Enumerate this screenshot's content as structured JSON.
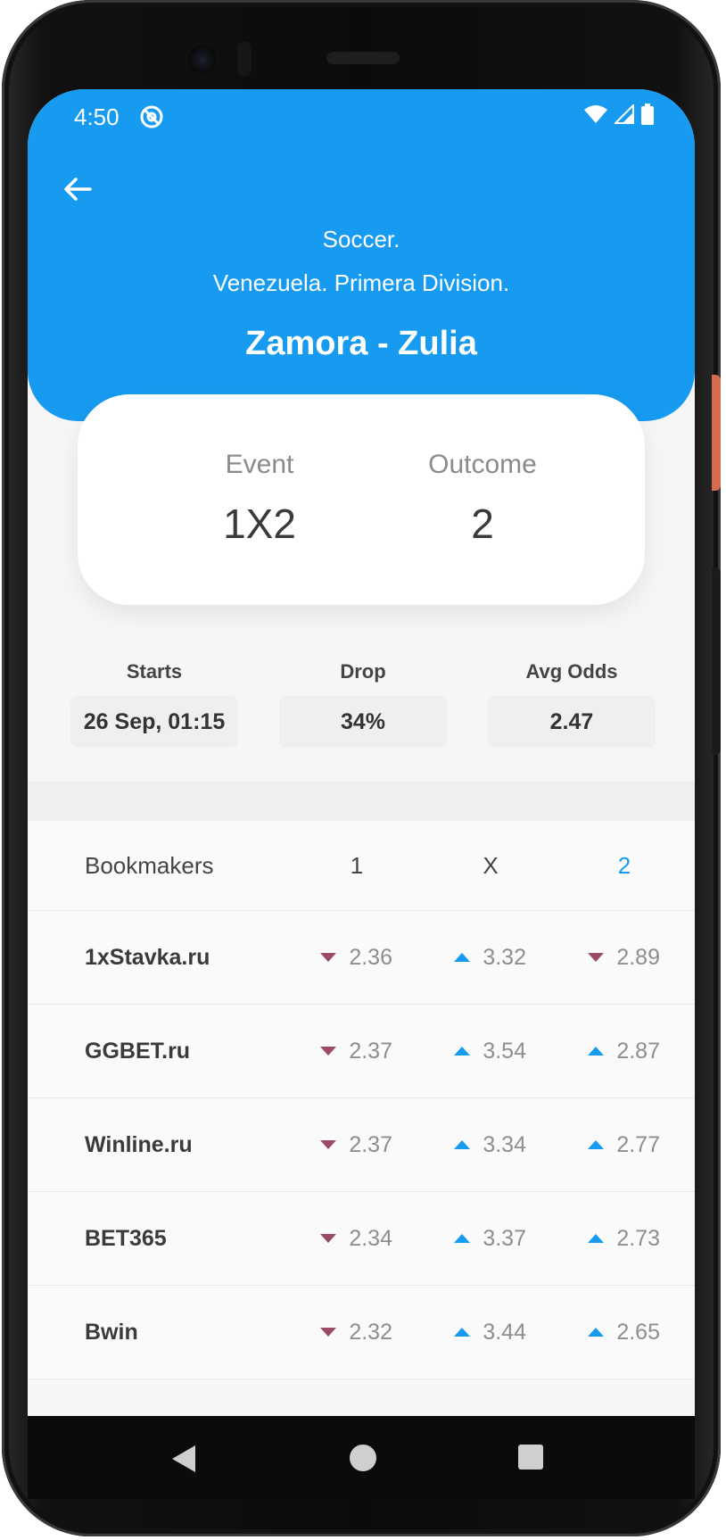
{
  "status_bar": {
    "time": "4:50"
  },
  "header": {
    "sport": "Soccer.",
    "league": "Venezuela. Primera Division.",
    "match": "Zamora - Zulia"
  },
  "card": {
    "event_label": "Event",
    "event_value": "1X2",
    "outcome_label": "Outcome",
    "outcome_value": "2"
  },
  "stats": {
    "starts_label": "Starts",
    "starts_value": "26 Sep, 01:15",
    "drop_label": "Drop",
    "drop_value": "34%",
    "avg_label": "Avg Odds",
    "avg_value": "2.47"
  },
  "table": {
    "headers": {
      "bookmakers": "Bookmakers",
      "c1": "1",
      "cx": "X",
      "c2": "2"
    },
    "rows": [
      {
        "name": "1xStavka.ru",
        "o1": "2.36",
        "o1_dir": "down",
        "ox": "3.32",
        "ox_dir": "up",
        "o2": "2.89",
        "o2_dir": "down"
      },
      {
        "name": "GGBET.ru",
        "o1": "2.37",
        "o1_dir": "down",
        "ox": "3.54",
        "ox_dir": "up",
        "o2": "2.87",
        "o2_dir": "up"
      },
      {
        "name": "Winline.ru",
        "o1": "2.37",
        "o1_dir": "down",
        "ox": "3.34",
        "ox_dir": "up",
        "o2": "2.77",
        "o2_dir": "up"
      },
      {
        "name": "BET365",
        "o1": "2.34",
        "o1_dir": "down",
        "ox": "3.37",
        "ox_dir": "up",
        "o2": "2.73",
        "o2_dir": "up"
      },
      {
        "name": "Bwin",
        "o1": "2.32",
        "o1_dir": "down",
        "ox": "3.44",
        "ox_dir": "up",
        "o2": "2.65",
        "o2_dir": "up"
      }
    ]
  },
  "colors": {
    "accent": "#169bf0",
    "down": "#9c4a6a",
    "up": "#169bf0"
  },
  "icons": [
    "back-arrow-icon",
    "wifi-icon",
    "signal-icon",
    "battery-icon",
    "nav-back-icon",
    "nav-home-icon",
    "nav-recent-icon"
  ]
}
